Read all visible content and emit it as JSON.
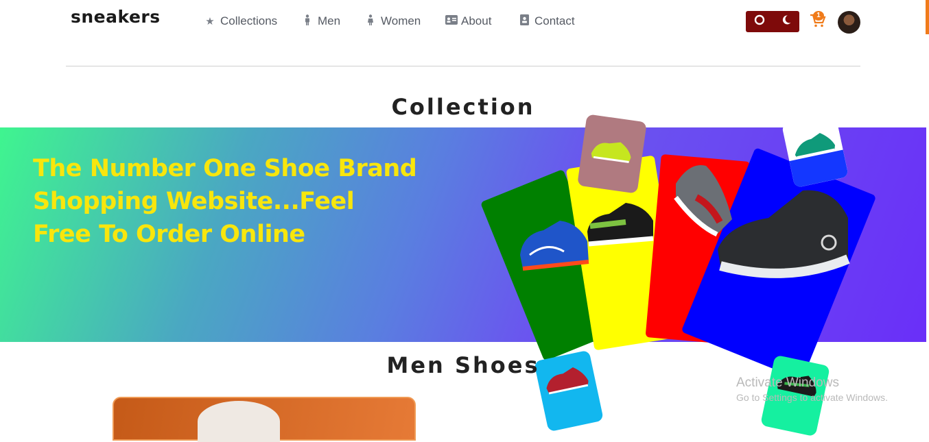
{
  "header": {
    "logo": "sneakers",
    "nav": [
      {
        "label": "Collections",
        "icon": "star-icon"
      },
      {
        "label": "Men",
        "icon": "man-icon"
      },
      {
        "label": "Women",
        "icon": "woman-icon"
      },
      {
        "label": "About",
        "icon": "id-card-icon"
      },
      {
        "label": "Contact",
        "icon": "contact-book-icon"
      }
    ],
    "cart_count": "1",
    "theme_icons": [
      "power-icon",
      "moon-icon"
    ]
  },
  "collection": {
    "title": "Collection",
    "tagline": [
      "The Number One Shoe Brand",
      "Shopping Website...Feel",
      "Free To Order Online"
    ]
  },
  "men": {
    "title": "Men Shoes"
  },
  "watermark": {
    "line1": "Activate Windows",
    "line2": "Go to Settings to activate Windows."
  },
  "colors": {
    "brand_accent": "#f07b1a",
    "toggle_bg": "#7e0a0a",
    "tagline": "#f8e60d",
    "card_green": "#008000",
    "card_yellow": "#ffff00",
    "card_red": "#ff0000",
    "card_blue": "#0000ff"
  }
}
